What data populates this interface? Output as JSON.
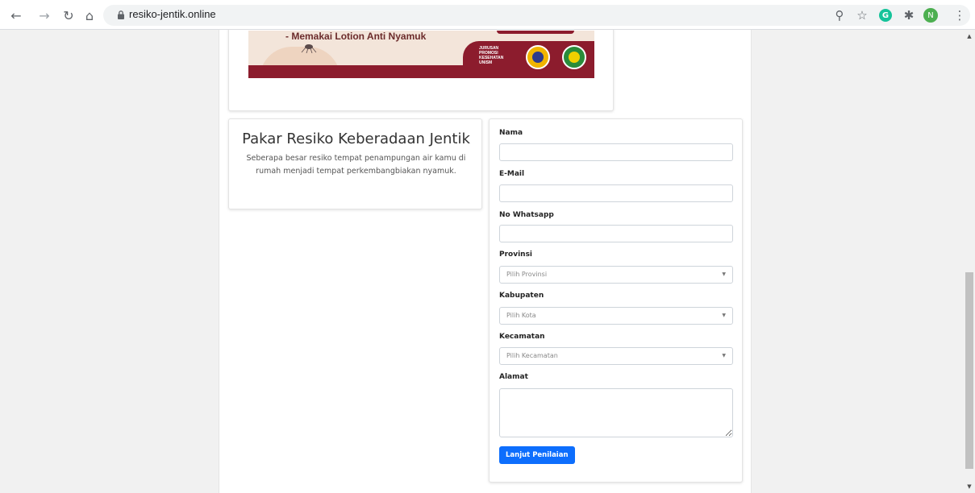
{
  "browser": {
    "url": "resiko-jentik.online",
    "icons": {
      "back": "arrow-left-icon",
      "forward": "arrow-right-icon",
      "reload": "reload-icon",
      "home": "home-icon",
      "lock": "lock-icon",
      "zoom": "zoom-icon",
      "bookmark": "star-icon",
      "grammarly": "grammarly-extension-icon",
      "extensions": "puzzle-icon",
      "profile": "profile-avatar-icon",
      "menu": "kebab-menu-icon"
    },
    "grammarly_letter": "G",
    "profile_initial": "N"
  },
  "banner": {
    "text": "- Memakai Lotion Anti Nyamuk",
    "brand_lines": [
      "JURUSAN",
      "PROMOSI",
      "KESEHATAN",
      "UNISM"
    ],
    "colors": {
      "maroon": "#8c1c2d",
      "cream": "#f3e5da"
    }
  },
  "intro": {
    "title": "Pakar Resiko Keberadaan Jentik",
    "description": "Seberapa besar resiko tempat penampungan air kamu di rumah menjadi tempat perkembangbiakan nyamuk."
  },
  "form": {
    "nama_label": "Nama",
    "nama_value": "",
    "email_label": "E-Mail",
    "email_value": "",
    "whatsapp_label": "No Whatsapp",
    "whatsapp_value": "",
    "provinsi_label": "Provinsi",
    "provinsi_placeholder": "Pilih Provinsi",
    "kabupaten_label": "Kabupaten",
    "kabupaten_placeholder": "Pilih Kota",
    "kecamatan_label": "Kecamatan",
    "kecamatan_placeholder": "Pilih Kecamatan",
    "alamat_label": "Alamat",
    "alamat_value": "",
    "submit_label": "Lanjut Penilaian",
    "accent_color": "#0d6efd"
  }
}
